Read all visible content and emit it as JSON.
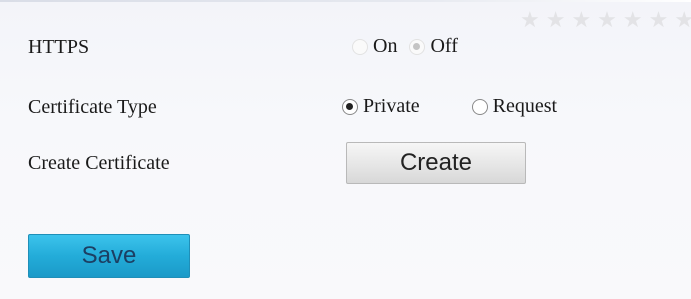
{
  "decor": {
    "stars": "★★★★★★★"
  },
  "form": {
    "https": {
      "label": "HTTPS",
      "options": [
        "On",
        "Off"
      ],
      "selected": "Off"
    },
    "certificate_type": {
      "label": "Certificate Type",
      "options": [
        "Private",
        "Request"
      ],
      "selected": "Private"
    },
    "create_certificate": {
      "label": "Create Certificate",
      "button_label": "Create"
    }
  },
  "actions": {
    "save_label": "Save"
  },
  "colors": {
    "save_button": "#23acd9",
    "save_text": "#1c3f63",
    "create_button": "#e6e6e6"
  }
}
